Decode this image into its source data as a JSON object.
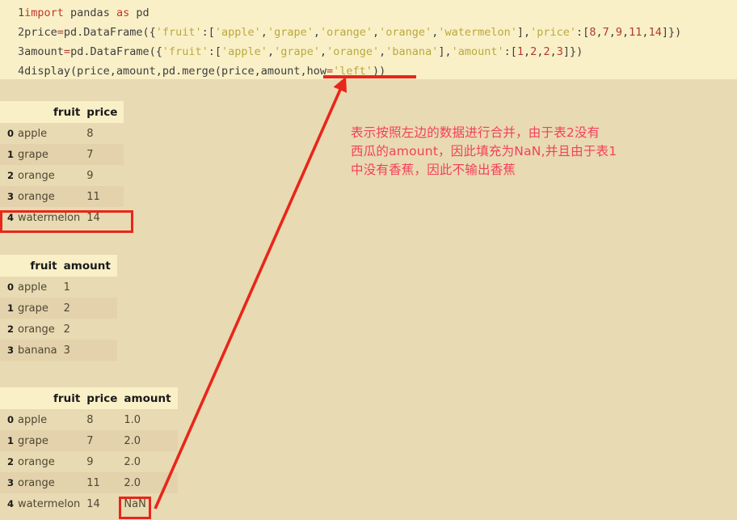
{
  "code": {
    "lines": [
      {
        "number": "1",
        "tokens": [
          {
            "t": "import",
            "c": "kw"
          },
          {
            "t": " pandas ",
            "c": "plain"
          },
          {
            "t": "as",
            "c": "kw"
          },
          {
            "t": " pd",
            "c": "plain"
          }
        ]
      },
      {
        "number": "2",
        "tokens": [
          {
            "t": "price",
            "c": "plain"
          },
          {
            "t": "=",
            "c": "op"
          },
          {
            "t": "pd.DataFrame({",
            "c": "plain"
          },
          {
            "t": "'fruit'",
            "c": "str"
          },
          {
            "t": ":[",
            "c": "plain"
          },
          {
            "t": "'apple'",
            "c": "str"
          },
          {
            "t": ",",
            "c": "plain"
          },
          {
            "t": "'grape'",
            "c": "str"
          },
          {
            "t": ",",
            "c": "plain"
          },
          {
            "t": "'orange'",
            "c": "str"
          },
          {
            "t": ",",
            "c": "plain"
          },
          {
            "t": "'orange'",
            "c": "str"
          },
          {
            "t": ",",
            "c": "plain"
          },
          {
            "t": "'watermelon'",
            "c": "str"
          },
          {
            "t": "],",
            "c": "plain"
          },
          {
            "t": "'price'",
            "c": "str"
          },
          {
            "t": ":[",
            "c": "plain"
          },
          {
            "t": "8",
            "c": "num"
          },
          {
            "t": ",",
            "c": "plain"
          },
          {
            "t": "7",
            "c": "num"
          },
          {
            "t": ",",
            "c": "plain"
          },
          {
            "t": "9",
            "c": "num"
          },
          {
            "t": ",",
            "c": "plain"
          },
          {
            "t": "11",
            "c": "num"
          },
          {
            "t": ",",
            "c": "plain"
          },
          {
            "t": "14",
            "c": "num"
          },
          {
            "t": "]})",
            "c": "plain"
          }
        ]
      },
      {
        "number": "3",
        "tokens": [
          {
            "t": "amount",
            "c": "plain"
          },
          {
            "t": "=",
            "c": "op"
          },
          {
            "t": "pd.DataFrame({",
            "c": "plain"
          },
          {
            "t": "'fruit'",
            "c": "str"
          },
          {
            "t": ":[",
            "c": "plain"
          },
          {
            "t": "'apple'",
            "c": "str"
          },
          {
            "t": ",",
            "c": "plain"
          },
          {
            "t": "'grape'",
            "c": "str"
          },
          {
            "t": ",",
            "c": "plain"
          },
          {
            "t": "'orange'",
            "c": "str"
          },
          {
            "t": ",",
            "c": "plain"
          },
          {
            "t": "'banana'",
            "c": "str"
          },
          {
            "t": "],",
            "c": "plain"
          },
          {
            "t": "'amount'",
            "c": "str"
          },
          {
            "t": ":[",
            "c": "plain"
          },
          {
            "t": "1",
            "c": "num"
          },
          {
            "t": ",",
            "c": "plain"
          },
          {
            "t": "2",
            "c": "num"
          },
          {
            "t": ",",
            "c": "plain"
          },
          {
            "t": "2",
            "c": "num"
          },
          {
            "t": ",",
            "c": "plain"
          },
          {
            "t": "3",
            "c": "num"
          },
          {
            "t": "]})",
            "c": "plain"
          }
        ]
      },
      {
        "number": "4",
        "tokens": [
          {
            "t": "display(price,amount,pd.merge(price,amount,how",
            "c": "plain"
          },
          {
            "t": "=",
            "c": "op"
          },
          {
            "t": "'left'",
            "c": "str"
          },
          {
            "t": "))",
            "c": "plain"
          }
        ]
      }
    ]
  },
  "tables": {
    "price": {
      "headers": [
        "",
        "fruit",
        "price"
      ],
      "rows": [
        {
          "index": "0",
          "fruit": "apple",
          "price": "8"
        },
        {
          "index": "1",
          "fruit": "grape",
          "price": "7"
        },
        {
          "index": "2",
          "fruit": "orange",
          "price": "9"
        },
        {
          "index": "3",
          "fruit": "orange",
          "price": "11"
        },
        {
          "index": "4",
          "fruit": "watermelon",
          "price": "14"
        }
      ]
    },
    "amount": {
      "headers": [
        "",
        "fruit",
        "amount"
      ],
      "rows": [
        {
          "index": "0",
          "fruit": "apple",
          "amount": "1"
        },
        {
          "index": "1",
          "fruit": "grape",
          "amount": "2"
        },
        {
          "index": "2",
          "fruit": "orange",
          "amount": "2"
        },
        {
          "index": "3",
          "fruit": "banana",
          "amount": "3"
        }
      ]
    },
    "merge": {
      "headers": [
        "",
        "fruit",
        "price",
        "amount"
      ],
      "rows": [
        {
          "index": "0",
          "fruit": "apple",
          "price": "8",
          "amount": "1.0"
        },
        {
          "index": "1",
          "fruit": "grape",
          "price": "7",
          "amount": "2.0"
        },
        {
          "index": "2",
          "fruit": "orange",
          "price": "9",
          "amount": "2.0"
        },
        {
          "index": "3",
          "fruit": "orange",
          "price": "11",
          "amount": "2.0"
        },
        {
          "index": "4",
          "fruit": "watermelon",
          "price": "14",
          "amount": "NaN"
        }
      ]
    }
  },
  "annotation": {
    "line1": "表示按照左边的数据进行合并，由于表2没有",
    "line2": "西瓜的amount，因此填充为NaN,并且由于表1",
    "line3": "中没有香蕉，因此不输出香蕉"
  },
  "colors": {
    "page_background": "#e8dab2",
    "code_background": "#faf0c8",
    "highlight_red": "#e8261a",
    "annotation_text": "#f4405a",
    "row_alt": "#e3d2ab",
    "string_token": "#b9a93d",
    "keyword_token": "#c0392b"
  }
}
